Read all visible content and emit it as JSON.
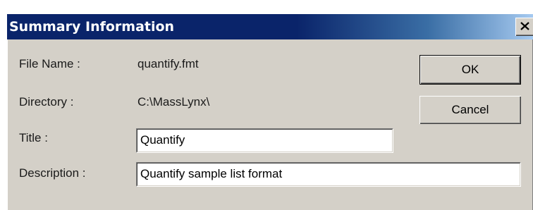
{
  "window": {
    "title": "Summary Information",
    "close_glyph": "close-icon"
  },
  "form": {
    "file_name_label": "File Name :",
    "file_name_value": "quantify.fmt",
    "directory_label": "Directory :",
    "directory_value": "C:\\MassLynx\\",
    "title_label": "Title :",
    "title_value": "Quantify",
    "description_label": "Description :",
    "description_value": "Quantify sample list format"
  },
  "buttons": {
    "ok_label": "OK",
    "cancel_label": "Cancel"
  },
  "colors": {
    "titlebar": "#0a246a",
    "dialog_face": "#d4d0c8",
    "field_bg": "#ffffff"
  }
}
